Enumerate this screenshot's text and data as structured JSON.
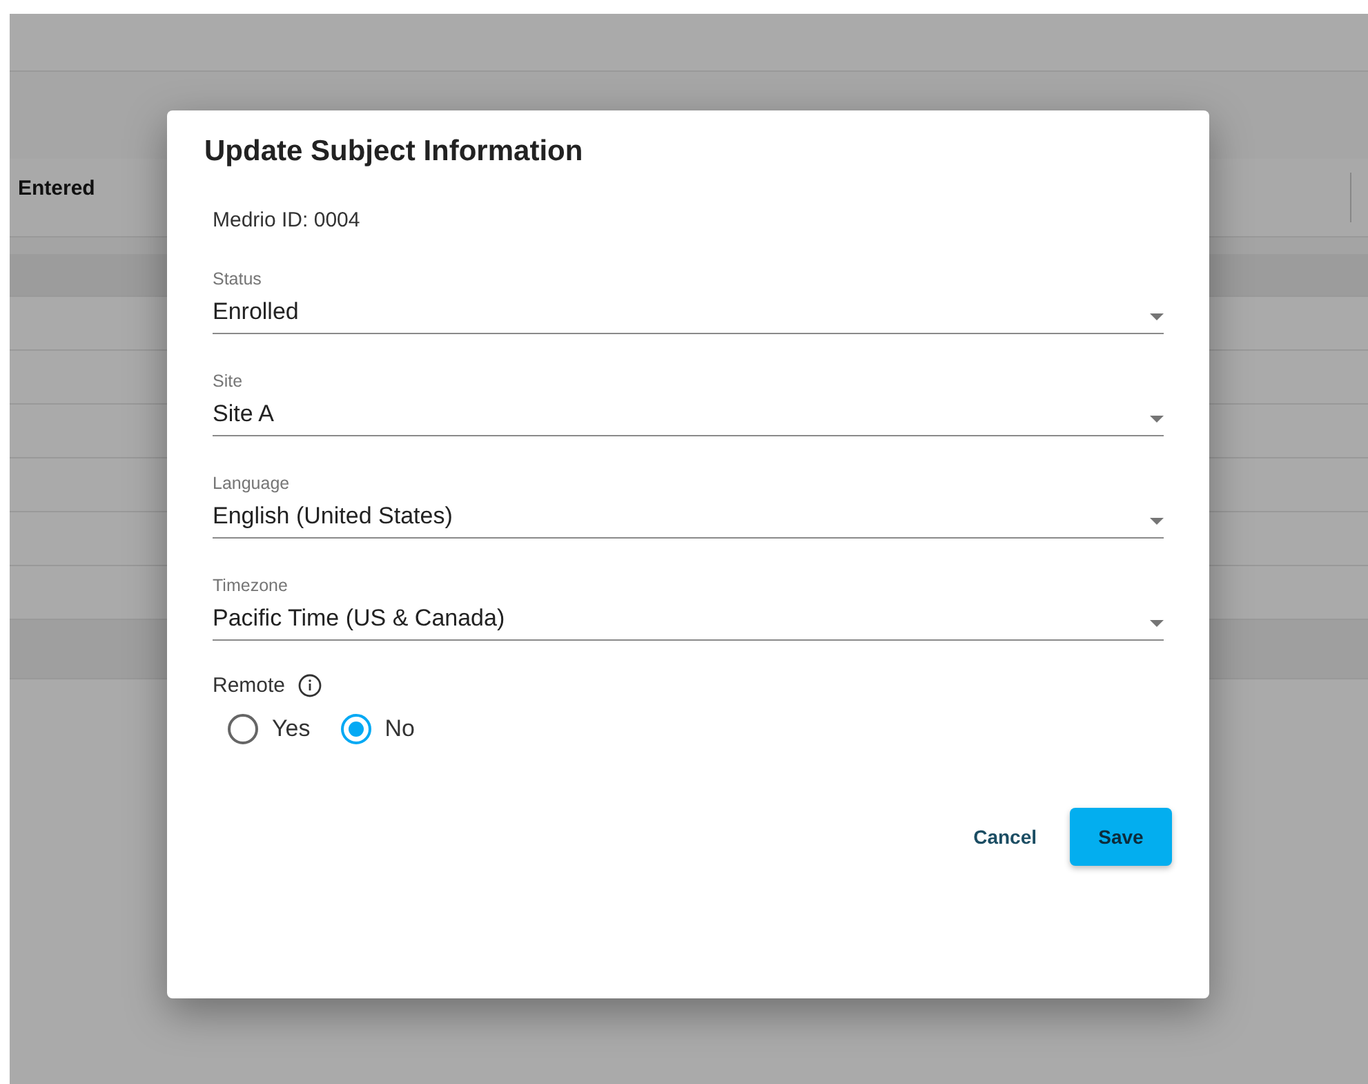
{
  "background_table": {
    "column_header": "Entered"
  },
  "dialog": {
    "title": "Update Subject Information",
    "id_label": "Medrio ID:",
    "id_value": "0004",
    "fields": [
      {
        "label": "Status",
        "value": "Enrolled"
      },
      {
        "label": "Site",
        "value": "Site A"
      },
      {
        "label": "Language",
        "value": "English (United States)"
      },
      {
        "label": "Timezone",
        "value": "Pacific Time (US & Canada)"
      }
    ],
    "remote": {
      "label": "Remote",
      "options": [
        {
          "label": "Yes",
          "selected": false
        },
        {
          "label": "No",
          "selected": true
        }
      ]
    },
    "buttons": [
      {
        "label": "Cancel",
        "kind": "text"
      },
      {
        "label": "Save",
        "kind": "primary"
      }
    ]
  }
}
